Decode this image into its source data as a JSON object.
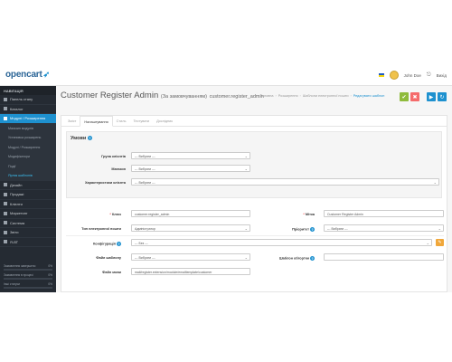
{
  "header": {
    "logo": "opencart",
    "logo_cart": "➶",
    "user": "John Doe",
    "logout": "Вихід"
  },
  "sidebar": {
    "heading": "НАВІГАЦІЯ",
    "items": [
      {
        "label": "Панель стану"
      },
      {
        "label": "Каталог"
      },
      {
        "label": "Модулі / Розширення",
        "active": true
      }
    ],
    "subitems": [
      {
        "label": "Магазин модулів"
      },
      {
        "label": "Установка розширень"
      },
      {
        "label": "Модулі / Розширення"
      },
      {
        "label": "Модифікатори"
      },
      {
        "label": "Події"
      },
      {
        "label": "Ярлик шаблонів",
        "current": true
      }
    ],
    "items2": [
      {
        "label": "Дизайн"
      },
      {
        "label": "Продажі"
      },
      {
        "label": "Клієнти"
      },
      {
        "label": "Маркетинг"
      },
      {
        "label": "Система"
      },
      {
        "label": "Звіти"
      },
      {
        "label": "Я-ВТ"
      }
    ],
    "stats": [
      {
        "label": "Замовлення завершено",
        "value": "0%",
        "fill": 0
      },
      {
        "label": "Замовлення в процесі",
        "value": "0%",
        "fill": 0
      },
      {
        "label": "Інші статуси",
        "value": "0%",
        "fill": 0
      }
    ]
  },
  "page": {
    "title": "Customer Register Admin",
    "title_small": "(За замовчуванням)",
    "title_route": "customer.register_admin",
    "breadcrumb": [
      "Головна",
      "Розширення",
      "Шаблони електронної пошти",
      "Редагувати шаблон"
    ]
  },
  "actions": {
    "save": "✔",
    "cancel": "✖",
    "preview": "▶",
    "reload": "↻"
  },
  "tabs": [
    "Зміст",
    "Налаштування",
    "Стиль",
    "Тестувати",
    "Дослідник"
  ],
  "conditions": {
    "title": "Умови",
    "fields": [
      {
        "label": "Група клієнтів",
        "value": "--- Вибрати ---"
      },
      {
        "label": "Магазин",
        "value": "--- Вибрати ---"
      },
      {
        "label": "Характеристики клієнта",
        "value": "--- Вибрати ---"
      }
    ]
  },
  "form": {
    "key_label": "Ключ",
    "key_value": "customer.register_admin",
    "label_label": "Мітка",
    "label_value": "Customer Register Admin",
    "type_label": "Тип електронної пошти",
    "type_value": "Адміністратор",
    "priority_label": "Пріоритет",
    "priority_value": "--- Вибрати ---",
    "config_label": "Конфігурація",
    "config_value": "--- Без ---",
    "template_label": "Файл шаблону",
    "template_value": "--- Вибрати ---",
    "wrapper_label": "Шаблон обгортки",
    "wrapper_value": "",
    "file_label": "Файл мови",
    "file_value": "mail/register.extension/module/emailtemplate/customer"
  },
  "colors": {
    "accent": "#1e91cf",
    "sidebar": "#252b33",
    "save": "#8fbb3c",
    "cancel": "#f56b6b",
    "config_button": "#f0a73a"
  }
}
